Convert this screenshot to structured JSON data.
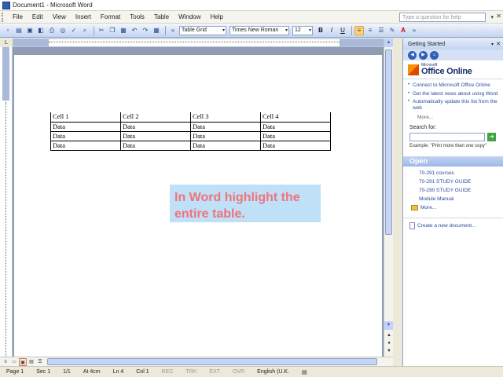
{
  "window": {
    "title": "Document1 - Microsoft Word"
  },
  "menu": {
    "items": [
      "File",
      "Edit",
      "View",
      "Insert",
      "Format",
      "Tools",
      "Table",
      "Window",
      "Help"
    ],
    "help_placeholder": "Type a question for help"
  },
  "toolbar": {
    "style": "Table Grid",
    "font": "Times New Roman",
    "size": "12",
    "bold": "B",
    "italic": "I",
    "underline": "U"
  },
  "document": {
    "table": {
      "header": [
        "Cell 1",
        "Cell 2",
        "Cell 3",
        "Cell 4"
      ],
      "rows": [
        [
          "Data",
          "Data",
          "Data",
          "Data"
        ],
        [
          "Data",
          "Data",
          "Data",
          "Data"
        ],
        [
          "Data",
          "Data",
          "Data",
          "Data"
        ]
      ]
    },
    "callout": "In Word highlight the entire table."
  },
  "taskpane": {
    "title": "Getting Started",
    "logo": {
      "small": "Microsoft",
      "main": "Office Online"
    },
    "links": [
      "Connect to Microsoft Office Online",
      "Get the latest news about using Word",
      "Automatically update this list from the web"
    ],
    "more": "More...",
    "search_label": "Search for:",
    "example": "Example: \"Print more than one copy\"",
    "open_heading": "Open",
    "open_items": [
      "70-291 courses",
      "70-291 STUDY GUIDE",
      "70-290 STUDY GUIDE",
      "Module Manual"
    ],
    "open_more": "More...",
    "create_new": "Create a new document..."
  },
  "statusbar": {
    "page": "Page 1",
    "section": "Sec 1",
    "pages": "1/1",
    "at": "At 4cm",
    "line": "Ln 4",
    "col": "Col 1",
    "rec": "REC",
    "trk": "TRK",
    "ext": "EXT",
    "ovr": "OVR",
    "language": "English (U.K."
  }
}
